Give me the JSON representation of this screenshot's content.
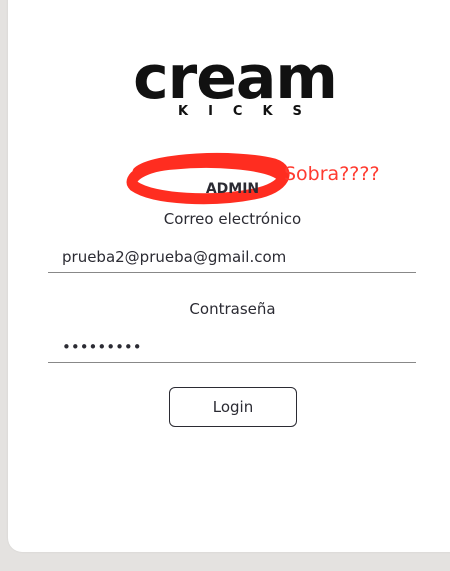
{
  "brand": {
    "name": "cream",
    "tagline": "KICKS"
  },
  "annotation": {
    "text": "Sobra????",
    "color": "#ff3b30"
  },
  "form": {
    "role_label": "ADMIN",
    "email": {
      "label": "Correo electrónico",
      "value": "prueba2@prueba@gmail.com"
    },
    "password": {
      "label": "Contraseña",
      "value": "passwordx"
    },
    "submit_label": "Login"
  }
}
